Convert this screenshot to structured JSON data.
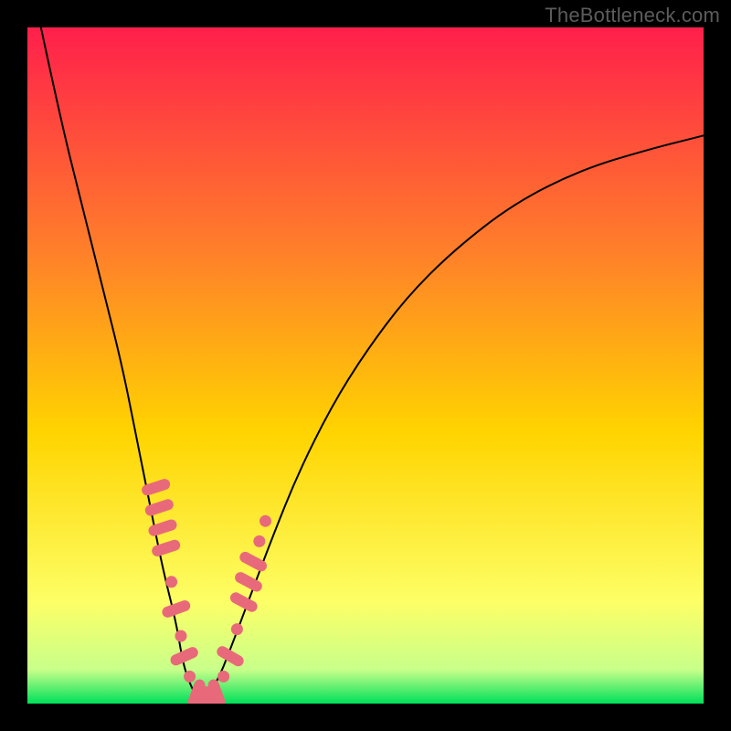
{
  "watermark": "TheBottleneck.com",
  "chart_data": {
    "type": "line",
    "title": "",
    "subtitle": "",
    "xlabel": "",
    "ylabel": "",
    "xlim": [
      0,
      100
    ],
    "ylim": [
      0,
      100
    ],
    "grid": false,
    "legend": false,
    "background_gradient": {
      "type": "vertical",
      "stops": [
        {
          "pos": 0.0,
          "color": "#ff1f4b"
        },
        {
          "pos": 0.33,
          "color": "#ff7f2a"
        },
        {
          "pos": 0.6,
          "color": "#ffd400"
        },
        {
          "pos": 0.85,
          "color": "#fdff66"
        },
        {
          "pos": 0.95,
          "color": "#c8ff8a"
        },
        {
          "pos": 1.0,
          "color": "#00e05a"
        }
      ]
    },
    "series": [
      {
        "name": "left-arm",
        "stroke": "#000000",
        "values": [
          {
            "x": 2,
            "y": 100
          },
          {
            "x": 5,
            "y": 86
          },
          {
            "x": 8,
            "y": 74
          },
          {
            "x": 11,
            "y": 62
          },
          {
            "x": 14,
            "y": 50
          },
          {
            "x": 16,
            "y": 40
          },
          {
            "x": 18,
            "y": 30
          },
          {
            "x": 20,
            "y": 20
          },
          {
            "x": 22,
            "y": 12
          },
          {
            "x": 23,
            "y": 6
          },
          {
            "x": 24,
            "y": 3
          },
          {
            "x": 25,
            "y": 1
          },
          {
            "x": 26,
            "y": 0
          }
        ]
      },
      {
        "name": "right-arm",
        "stroke": "#000000",
        "values": [
          {
            "x": 26,
            "y": 0
          },
          {
            "x": 28,
            "y": 3
          },
          {
            "x": 30,
            "y": 8
          },
          {
            "x": 33,
            "y": 16
          },
          {
            "x": 36,
            "y": 24
          },
          {
            "x": 40,
            "y": 34
          },
          {
            "x": 45,
            "y": 44
          },
          {
            "x": 50,
            "y": 52
          },
          {
            "x": 56,
            "y": 60
          },
          {
            "x": 63,
            "y": 67
          },
          {
            "x": 72,
            "y": 74
          },
          {
            "x": 82,
            "y": 79
          },
          {
            "x": 92,
            "y": 82
          },
          {
            "x": 100,
            "y": 84
          }
        ]
      }
    ],
    "markers": [
      {
        "x": 19.0,
        "y": 32,
        "kind": "capsule",
        "angle": 72
      },
      {
        "x": 19.5,
        "y": 29,
        "kind": "capsule",
        "angle": 72
      },
      {
        "x": 20.0,
        "y": 26,
        "kind": "capsule",
        "angle": 72
      },
      {
        "x": 20.5,
        "y": 23,
        "kind": "capsule",
        "angle": 72
      },
      {
        "x": 21.3,
        "y": 18,
        "kind": "dot"
      },
      {
        "x": 22.0,
        "y": 14,
        "kind": "capsule",
        "angle": 70
      },
      {
        "x": 22.7,
        "y": 10,
        "kind": "dot"
      },
      {
        "x": 23.2,
        "y": 7,
        "kind": "capsule",
        "angle": 66
      },
      {
        "x": 24.0,
        "y": 4,
        "kind": "dot"
      },
      {
        "x": 25.0,
        "y": 1.5,
        "kind": "capsule",
        "angle": 20
      },
      {
        "x": 26.0,
        "y": 0.5,
        "kind": "capsule",
        "angle": 0
      },
      {
        "x": 27.0,
        "y": 0.5,
        "kind": "capsule",
        "angle": 0
      },
      {
        "x": 28.0,
        "y": 1.5,
        "kind": "capsule",
        "angle": -20
      },
      {
        "x": 29.0,
        "y": 4,
        "kind": "dot"
      },
      {
        "x": 30.0,
        "y": 7,
        "kind": "capsule",
        "angle": -60
      },
      {
        "x": 31.0,
        "y": 11,
        "kind": "dot"
      },
      {
        "x": 32.0,
        "y": 15,
        "kind": "capsule",
        "angle": -62
      },
      {
        "x": 32.7,
        "y": 18,
        "kind": "capsule",
        "angle": -62
      },
      {
        "x": 33.4,
        "y": 21,
        "kind": "capsule",
        "angle": -62
      },
      {
        "x": 34.3,
        "y": 24,
        "kind": "dot"
      },
      {
        "x": 35.2,
        "y": 27,
        "kind": "dot"
      }
    ],
    "marker_color": "#e86a7a"
  }
}
